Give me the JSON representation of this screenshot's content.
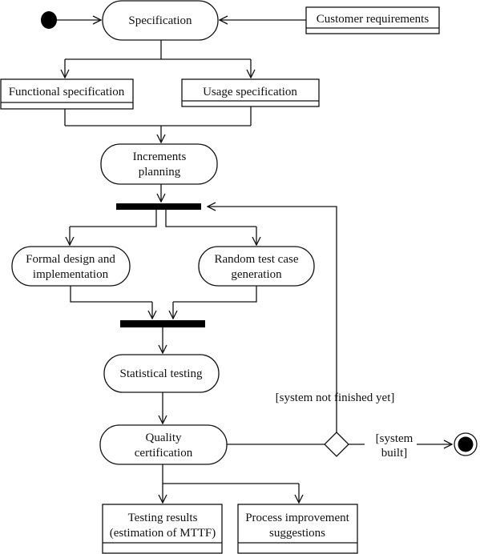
{
  "diagram": {
    "type": "UML activity diagram",
    "actions": {
      "specification": "Specification",
      "increments_planning": [
        "Increments",
        "planning"
      ],
      "formal_design": [
        "Formal design and",
        "implementation"
      ],
      "random_test": [
        "Random test case",
        "generation"
      ],
      "statistical_testing": "Statistical testing",
      "quality_certification": [
        "Quality",
        "certification"
      ]
    },
    "objects": {
      "customer_requirements": "Customer requirements",
      "functional_specification": "Functional specification",
      "usage_specification": "Usage specification",
      "testing_results": [
        "Testing results",
        "(estimation of MTTF)"
      ],
      "process_improvement": [
        "Process improvement",
        "suggestions"
      ]
    },
    "guards": {
      "not_finished": "[system not finished yet]",
      "built": [
        "[system",
        "built]"
      ]
    }
  }
}
